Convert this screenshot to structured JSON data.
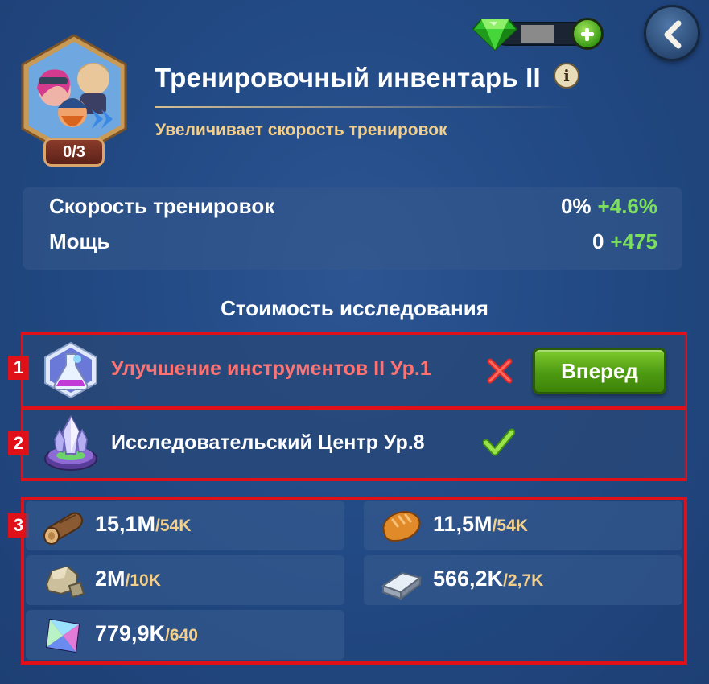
{
  "currency": {
    "gem_icon": "green-gem-icon",
    "add_icon": "plus-icon"
  },
  "header": {
    "title": "Тренировочный инвентарь II",
    "subtitle": "Увеличивает скорость тренировок",
    "progress": "0/3",
    "info_icon": "i"
  },
  "stats": [
    {
      "label": "Скорость тренировок",
      "current": "0%",
      "bonus": "+4.6%"
    },
    {
      "label": "Мощь",
      "current": "0",
      "bonus": "+475"
    }
  ],
  "cost": {
    "title": "Стоимость исследования",
    "requirements": [
      {
        "badge": "1",
        "label": "Улучшение инструментов II Ур.1",
        "met": false,
        "button": "Вперед"
      },
      {
        "badge": "2",
        "label": "Исследовательский Центр Ур.8",
        "met": true
      }
    ],
    "resources_badge": "3",
    "resources": [
      {
        "icon": "wood-icon",
        "have": "15,1M",
        "need": "/54K"
      },
      {
        "icon": "bread-icon",
        "have": "11,5M",
        "need": "/54K"
      },
      {
        "icon": "stone-icon",
        "have": "2M",
        "need": "/10K"
      },
      {
        "icon": "iron-ingot-icon",
        "have": "566,2K",
        "need": "/2,7K"
      },
      {
        "icon": "crystal-icon",
        "have": "779,9K",
        "need": "/640"
      }
    ]
  },
  "colors": {
    "accent_green": "#7ce05c",
    "fail_red": "#ff7272",
    "highlight_frame": "#e01018",
    "subtitle_gold": "#f2cf8c"
  }
}
